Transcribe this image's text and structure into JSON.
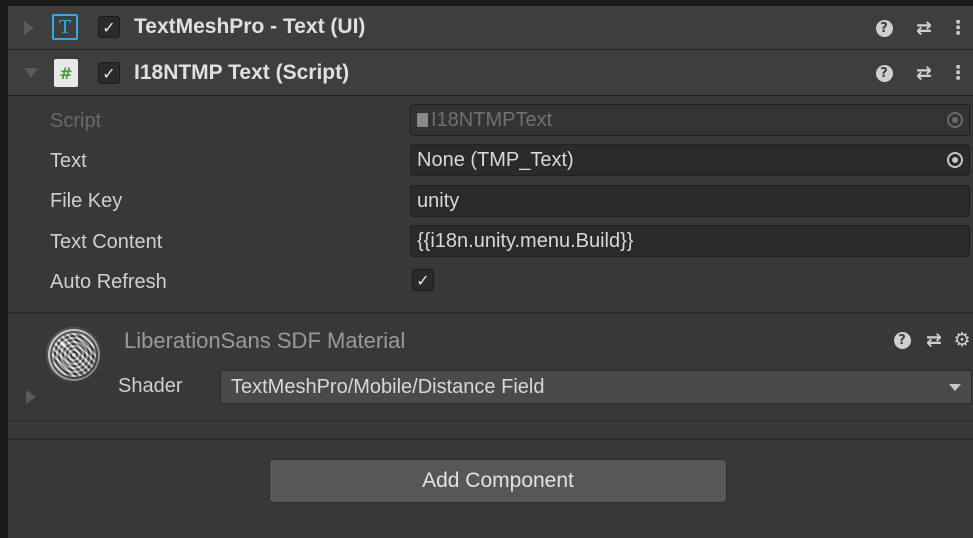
{
  "components": [
    {
      "title": "TextMeshPro - Text (UI)",
      "icon": "text-t-icon",
      "enabled": true,
      "expanded": false
    },
    {
      "title": "I18NTMP Text (Script)",
      "icon": "csharp-script-hash-icon",
      "enabled": true,
      "expanded": true,
      "fields": {
        "script": {
          "label": "Script",
          "value": "I18NTMPText"
        },
        "text": {
          "label": "Text",
          "value": "None (TMP_Text)"
        },
        "file_key": {
          "label": "File Key",
          "value": "unity"
        },
        "text_content": {
          "label": "Text Content",
          "value": "{{i18n.unity.menu.Build}}"
        },
        "auto_refresh": {
          "label": "Auto Refresh",
          "checked": true
        }
      }
    }
  ],
  "header_icons": {
    "help_glyph": "?",
    "presets_glyph": "⇄",
    "menu_glyph": "⋮",
    "gear_glyph": "⚙"
  },
  "material": {
    "name": "LiberationSans SDF Material",
    "shader_label": "Shader",
    "shader_value": "TextMeshPro/Mobile/Distance Field"
  },
  "add_component": {
    "label": "Add Component"
  },
  "check_glyph": "✓",
  "colors": {
    "background": "#383838",
    "header": "#3e3e3e",
    "field": "#2a2a2a",
    "accent_blue": "#3aa4e8",
    "button": "#575757"
  }
}
